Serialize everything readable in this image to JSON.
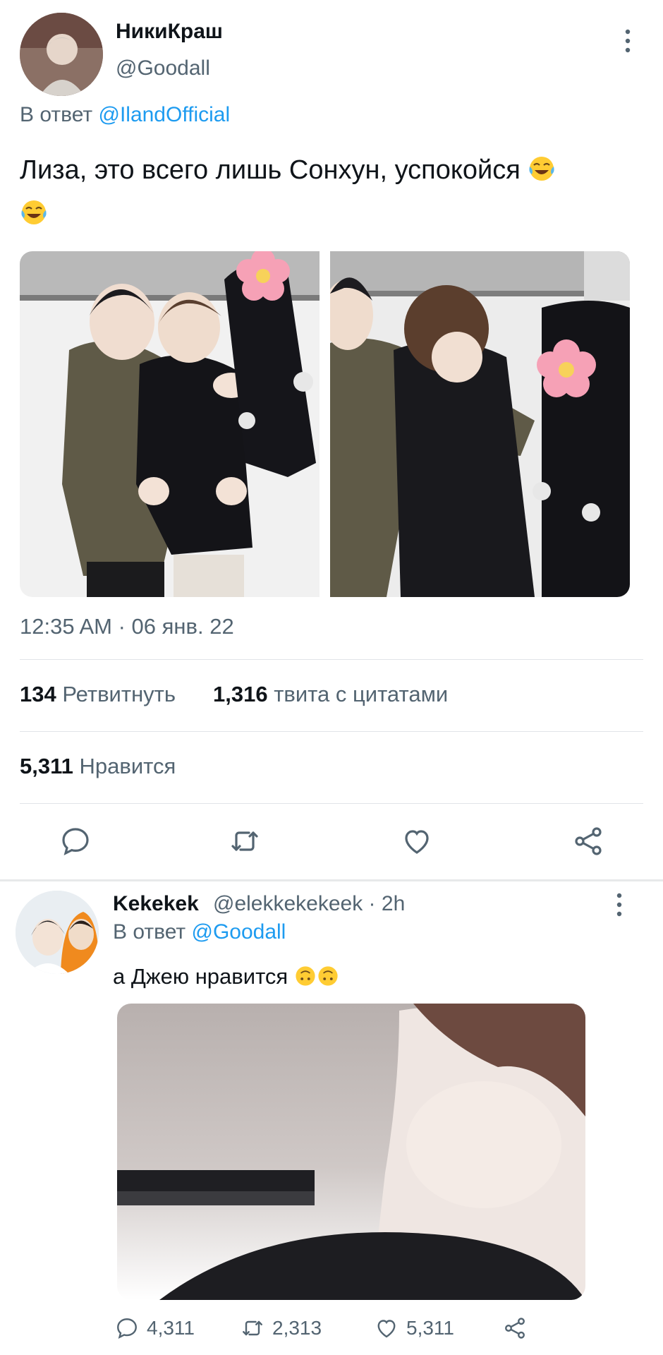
{
  "tweet": {
    "author_name": "НикиКраш",
    "author_handle": "@Goodall",
    "reply_prefix": "В ответ",
    "reply_to": "@IlandOfficial",
    "text": "Лиза, это всего лишь Сонхун, успокойся",
    "emoji": [
      "face-with-tears-of-joy",
      "face-with-tears-of-joy"
    ],
    "timestamp": "12:35 AM · 06 янв. 22",
    "retweets": {
      "count": "134",
      "label": "Ретвитнуть"
    },
    "quotes": {
      "count": "1,316",
      "label": "твита с цитатами"
    },
    "likes": {
      "count": "5,311",
      "label": "Нравится"
    },
    "actions": [
      "reply-icon",
      "retweet-icon",
      "like-icon",
      "share-icon"
    ]
  },
  "reply": {
    "author_name": "Kekekek",
    "author_handle": "@elekkekekeek · 2h",
    "reply_prefix": "В ответ",
    "reply_to": "@Goodall",
    "text": "а Джею нравится",
    "emoji": [
      "upside-down-face",
      "upside-down-face"
    ],
    "counts": {
      "replies": "4,311",
      "retweets": "2,313",
      "likes": "5,311"
    },
    "actions": [
      "reply-icon",
      "retweet-icon",
      "like-icon",
      "share-icon"
    ]
  },
  "colors": {
    "accent": "#1d9bf0",
    "text": "#0f1419",
    "muted": "#536471",
    "divider": "#e1e4e8"
  }
}
